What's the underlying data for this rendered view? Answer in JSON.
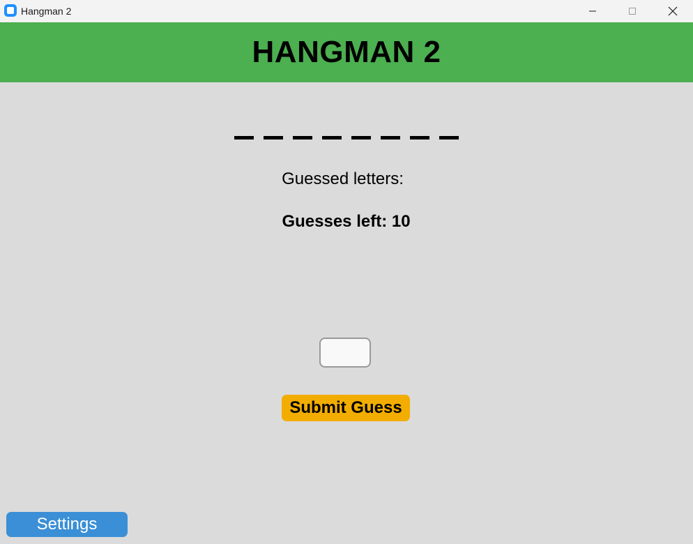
{
  "window": {
    "title": "Hangman 2",
    "icon": "app-icon",
    "controls": [
      "minimize-icon",
      "maximize-icon",
      "close-icon"
    ]
  },
  "header": {
    "title": "HANGMAN 2",
    "background": "#4caf50"
  },
  "game": {
    "word_blank_count": 8,
    "guessed_letters_label": "Guessed letters:",
    "guesses_left_label": "Guesses left: 10"
  },
  "input": {
    "value": "",
    "placeholder": ""
  },
  "buttons": {
    "submit_label": "Submit Guess",
    "submit_color": "#f2ad00",
    "settings_label": "Settings",
    "settings_color": "#3a8fd6"
  }
}
